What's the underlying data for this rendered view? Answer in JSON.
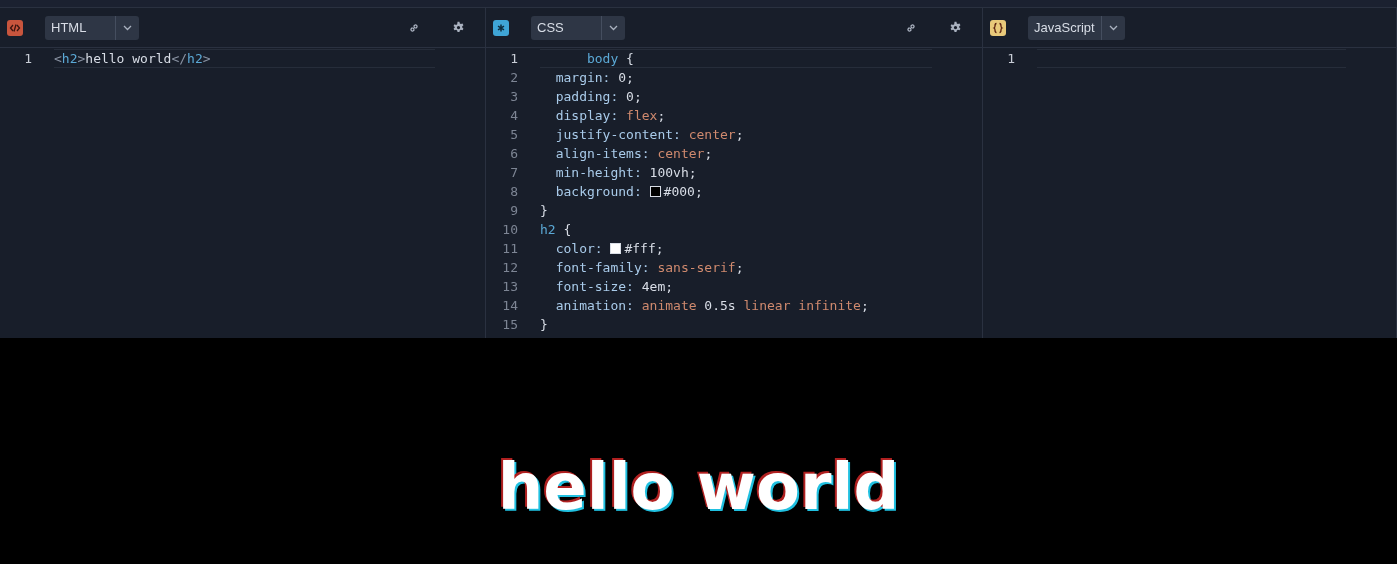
{
  "editors": [
    {
      "kind": "html",
      "language": "HTML",
      "buttons": [
        {
          "kind": "link"
        },
        {
          "kind": "settings"
        }
      ],
      "lines": [
        {
          "number": "1",
          "tokens": [
            {
              "text": "<",
              "kind": "punc"
            },
            {
              "text": "h2",
              "kind": "tag"
            },
            {
              "text": ">",
              "kind": "punc"
            },
            {
              "text": "hello world",
              "kind": "text"
            },
            {
              "text": "</",
              "kind": "punc"
            },
            {
              "text": "h2",
              "kind": "tag"
            },
            {
              "text": ">",
              "kind": "punc"
            }
          ]
        }
      ]
    },
    {
      "kind": "css",
      "language": "CSS",
      "buttons": [
        {
          "kind": "link"
        },
        {
          "kind": "settings"
        }
      ],
      "lines": [
        {
          "number": "1",
          "tokens": [
            {
              "text": "      body ",
              "kind": "tag"
            },
            {
              "text": "{",
              "kind": "text"
            }
          ]
        },
        {
          "number": "2",
          "tokens": [
            {
              "text": "  margin: ",
              "kind": "prop"
            },
            {
              "text": "0;",
              "kind": "text"
            }
          ]
        },
        {
          "number": "3",
          "tokens": [
            {
              "text": "  padding: ",
              "kind": "prop"
            },
            {
              "text": "0;",
              "kind": "text"
            }
          ]
        },
        {
          "number": "4",
          "tokens": [
            {
              "text": "  display: ",
              "kind": "prop"
            },
            {
              "text": "flex",
              "kind": "value"
            },
            {
              "text": ";",
              "kind": "text"
            }
          ]
        },
        {
          "number": "5",
          "tokens": [
            {
              "text": "  justify-content: ",
              "kind": "prop"
            },
            {
              "text": "center",
              "kind": "value"
            },
            {
              "text": ";",
              "kind": "text"
            }
          ]
        },
        {
          "number": "6",
          "tokens": [
            {
              "text": "  align-items: ",
              "kind": "prop"
            },
            {
              "text": "center",
              "kind": "value"
            },
            {
              "text": ";",
              "kind": "text"
            }
          ]
        },
        {
          "number": "7",
          "tokens": [
            {
              "text": "  min-height: ",
              "kind": "prop"
            },
            {
              "text": "100vh;",
              "kind": "text"
            }
          ]
        },
        {
          "number": "8",
          "tokens": [
            {
              "text": "  background: ",
              "kind": "prop"
            },
            {
              "kind": "swatch",
              "color": "#000000"
            },
            {
              "text": "#000;",
              "kind": "text"
            }
          ]
        },
        {
          "number": "9",
          "tokens": [
            {
              "text": "}",
              "kind": "text"
            }
          ]
        },
        {
          "number": "10",
          "tokens": [
            {
              "text": "h2 ",
              "kind": "tag"
            },
            {
              "text": "{",
              "kind": "text"
            }
          ]
        },
        {
          "number": "11",
          "tokens": [
            {
              "text": "  color: ",
              "kind": "prop"
            },
            {
              "kind": "swatch",
              "color": "#ffffff"
            },
            {
              "text": "#fff;",
              "kind": "text"
            }
          ]
        },
        {
          "number": "12",
          "tokens": [
            {
              "text": "  font-family: ",
              "kind": "prop"
            },
            {
              "text": "sans-serif",
              "kind": "value"
            },
            {
              "text": ";",
              "kind": "text"
            }
          ]
        },
        {
          "number": "13",
          "tokens": [
            {
              "text": "  font-size: ",
              "kind": "prop"
            },
            {
              "text": "4em;",
              "kind": "text"
            }
          ]
        },
        {
          "number": "14",
          "tokens": [
            {
              "text": "  animation: ",
              "kind": "prop"
            },
            {
              "text": "animate",
              "kind": "value"
            },
            {
              "text": " 0.5s ",
              "kind": "text"
            },
            {
              "text": "linear infinite",
              "kind": "value"
            },
            {
              "text": ";",
              "kind": "text"
            }
          ]
        },
        {
          "number": "15",
          "tokens": [
            {
              "text": "}",
              "kind": "text"
            }
          ]
        }
      ]
    },
    {
      "kind": "js",
      "language": "JavaScript",
      "lines": [
        {
          "number": "1"
        }
      ]
    }
  ],
  "preview": {
    "heading": "hello world"
  }
}
